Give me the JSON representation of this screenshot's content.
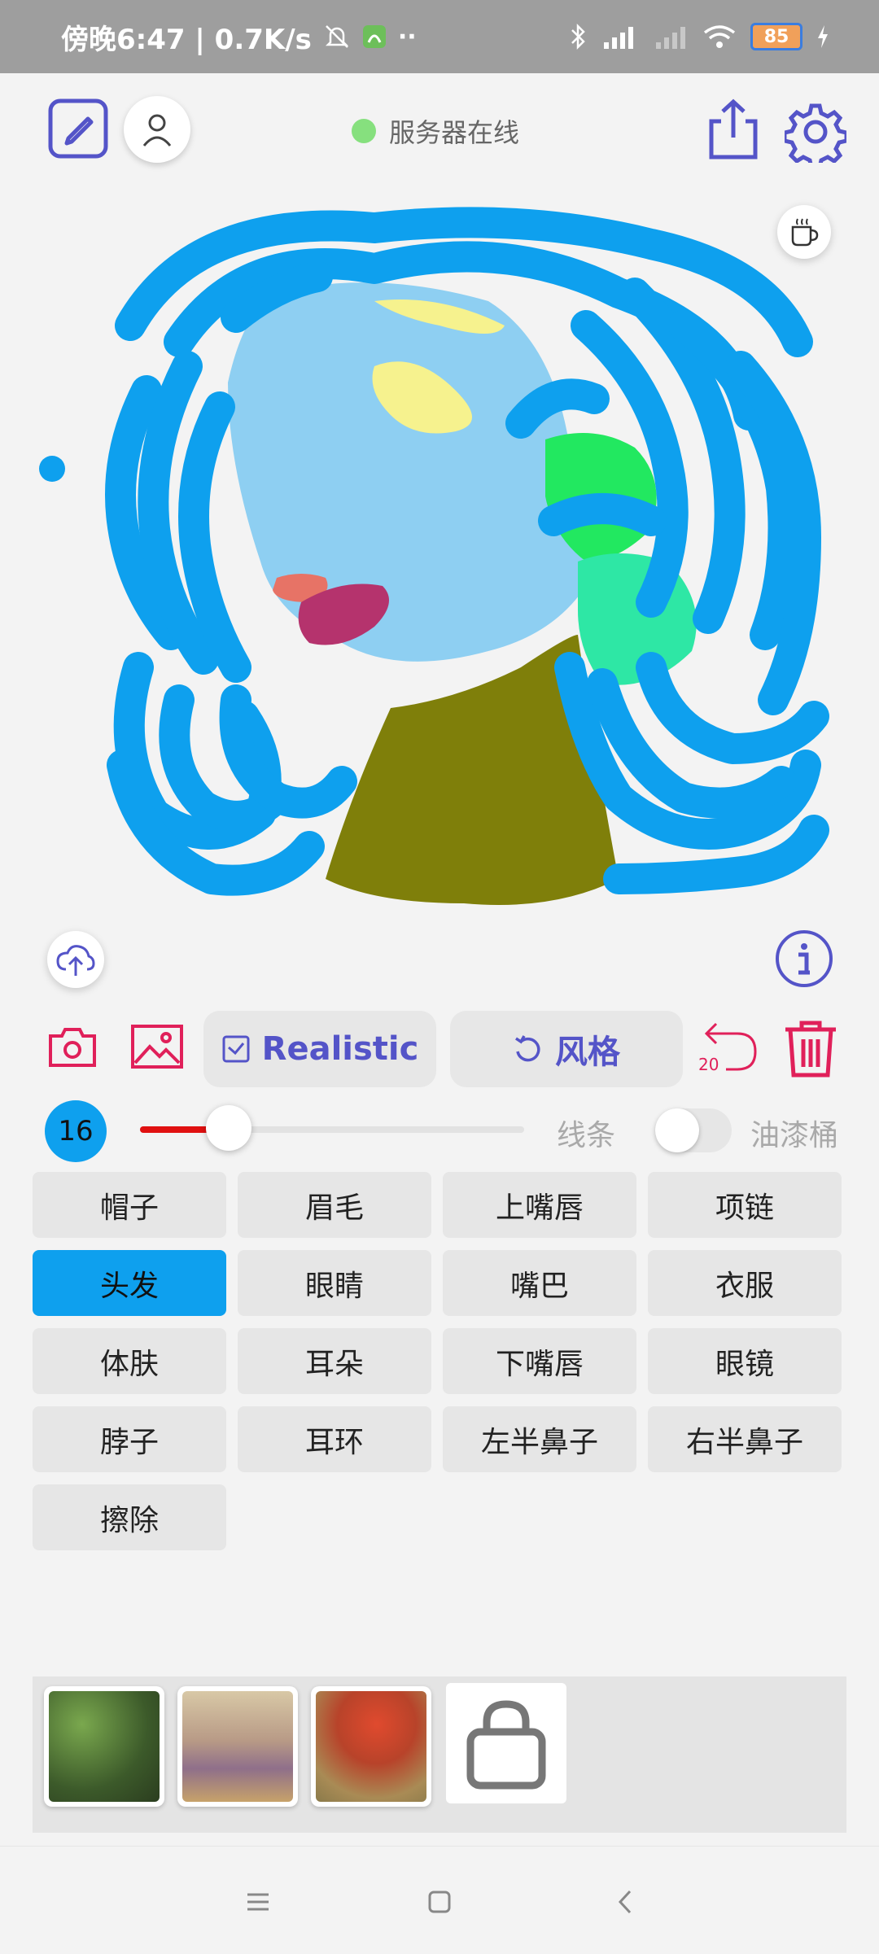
{
  "status_bar": {
    "time_text": "傍晚6:47 | 0.7K/s",
    "battery": "85"
  },
  "header": {
    "server_status": "服务器在线"
  },
  "toolbar": {
    "style_label": "Realistic",
    "style_button_label": "风格",
    "undo_count": "20"
  },
  "brush": {
    "size": "16",
    "size_fraction": 0.23,
    "line_label": "线条",
    "bucket_label": "油漆桶",
    "bucket_enabled": false
  },
  "categories": [
    {
      "label": "帽子",
      "active": false
    },
    {
      "label": "眉毛",
      "active": false
    },
    {
      "label": "上嘴唇",
      "active": false
    },
    {
      "label": "项链",
      "active": false
    },
    {
      "label": "头发",
      "active": true
    },
    {
      "label": "眼睛",
      "active": false
    },
    {
      "label": "嘴巴",
      "active": false
    },
    {
      "label": "衣服",
      "active": false
    },
    {
      "label": "体肤",
      "active": false
    },
    {
      "label": "耳朵",
      "active": false
    },
    {
      "label": "下嘴唇",
      "active": false
    },
    {
      "label": "眼镜",
      "active": false
    },
    {
      "label": "脖子",
      "active": false
    },
    {
      "label": "耳环",
      "active": false
    },
    {
      "label": "左半鼻子",
      "active": false
    },
    {
      "label": "右半鼻子",
      "active": false
    },
    {
      "label": "擦除",
      "active": false
    }
  ],
  "colors": {
    "accent": "#5454c8",
    "active_category": "#0ea0ee",
    "danger": "#e0205a",
    "hair": "#0ea0ee",
    "skin": "#8ecff2",
    "clothes": "#7f7f0a"
  },
  "icons": {
    "sketch": "pencil-square-icon",
    "user": "user-icon",
    "share": "share-icon",
    "settings": "gear-icon",
    "coffee": "coffee-icon",
    "upload": "cloud-upload-icon",
    "info": "info-icon",
    "camera": "camera-icon",
    "image": "image-icon",
    "undo": "undo-icon",
    "delete": "trash-icon",
    "lock": "lock-icon"
  }
}
